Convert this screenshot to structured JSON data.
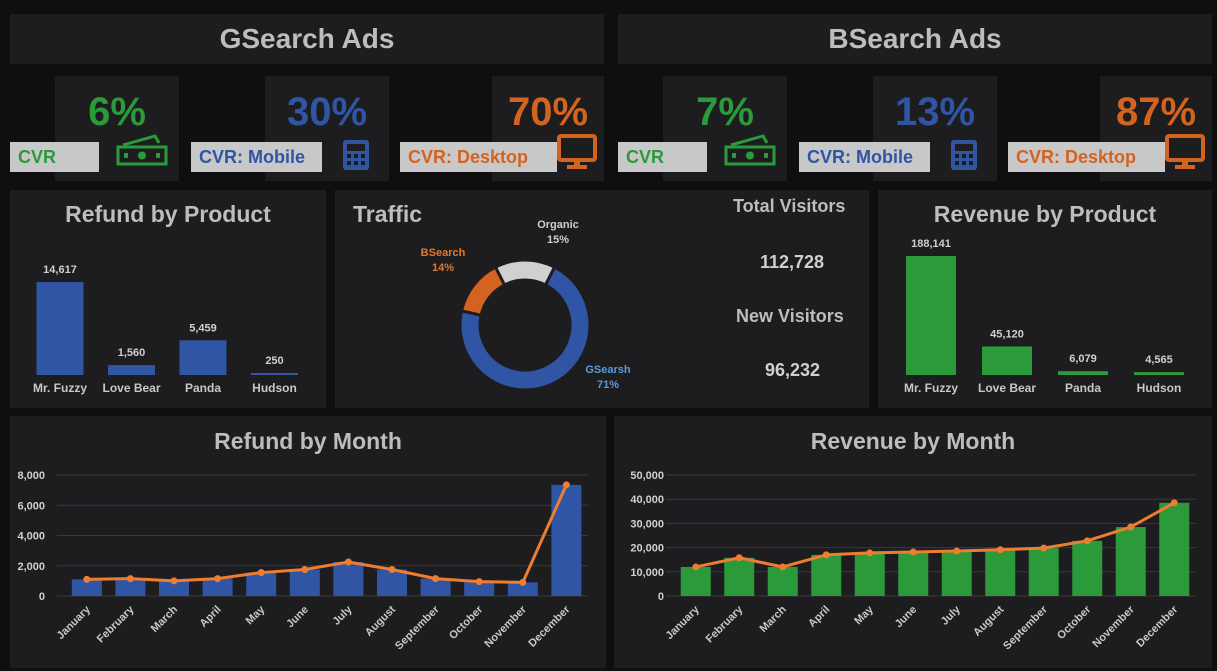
{
  "gsearch": {
    "title": "GSearch Ads",
    "kpis": [
      {
        "value": "6%",
        "label": "CVR",
        "icon": "money-icon",
        "color": "#2a9a3a"
      },
      {
        "value": "30%",
        "label": "CVR: Mobile",
        "icon": "calculator-icon",
        "color": "#2f55a4"
      },
      {
        "value": "70%",
        "label": "CVR: Desktop",
        "icon": "monitor-icon",
        "color": "#d4631f"
      }
    ]
  },
  "bsearch": {
    "title": "BSearch Ads",
    "kpis": [
      {
        "value": "7%",
        "label": "CVR",
        "icon": "money-icon",
        "color": "#2a9a3a"
      },
      {
        "value": "13%",
        "label": "CVR: Mobile",
        "icon": "calculator-icon",
        "color": "#2f55a4"
      },
      {
        "value": "87%",
        "label": "CVR: Desktop",
        "icon": "monitor-icon",
        "color": "#d4631f"
      }
    ]
  },
  "traffic": {
    "total_label": "Total Visitors",
    "total_value": "112,728",
    "new_label": "New Visitors",
    "new_value": "96,232"
  },
  "chart_data": [
    {
      "id": "refund-product",
      "type": "bar",
      "title": "Refund by Product",
      "categories": [
        "Mr. Fuzzy",
        "Love Bear",
        "Panda",
        "Hudson"
      ],
      "values": [
        14617,
        1560,
        5459,
        250
      ],
      "value_labels": [
        "14,617",
        "1,560",
        "5,459",
        "250"
      ],
      "color": "#2f55a4"
    },
    {
      "id": "traffic",
      "type": "pie",
      "title": "Traffic",
      "slices": [
        {
          "name": "GSearsh",
          "value": 71,
          "label": "71%",
          "color": "#2f55a4",
          "label_color": "#5b9bd5"
        },
        {
          "name": "BSearch",
          "value": 14,
          "label": "14%",
          "color": "#d4631f",
          "label_color": "#e0792f"
        },
        {
          "name": "Organic",
          "value": 15,
          "label": "15%",
          "color": "#d0d0d0",
          "label_color": "#d0d0d0"
        }
      ]
    },
    {
      "id": "revenue-product",
      "type": "bar",
      "title": "Revenue by Product",
      "categories": [
        "Mr. Fuzzy",
        "Love Bear",
        "Panda",
        "Hudson"
      ],
      "values": [
        188141,
        45120,
        6079,
        4565
      ],
      "value_labels": [
        "188,141",
        "45,120",
        "6,079",
        "4,565"
      ],
      "color": "#2a9a3a"
    },
    {
      "id": "refund-month",
      "type": "bar",
      "title": "Refund by Month",
      "categories": [
        "January",
        "February",
        "March",
        "April",
        "May",
        "June",
        "July",
        "August",
        "September",
        "October",
        "November",
        "December"
      ],
      "values": [
        1100,
        1150,
        1000,
        1150,
        1550,
        1750,
        2250,
        1750,
        1150,
        950,
        900,
        7350
      ],
      "line_values": [
        1100,
        1150,
        1000,
        1150,
        1550,
        1750,
        2250,
        1750,
        1150,
        950,
        900,
        7350
      ],
      "ylim": [
        0,
        8000
      ],
      "yticks": [
        "0",
        "2,000",
        "4,000",
        "6,000",
        "8,000"
      ],
      "ytick_values": [
        0,
        2000,
        4000,
        6000,
        8000
      ],
      "color": "#2f55a4",
      "line_color": "#ed7d31"
    },
    {
      "id": "revenue-month",
      "type": "bar",
      "title": "Revenue by Month",
      "categories": [
        "January",
        "February",
        "March",
        "April",
        "May",
        "June",
        "July",
        "August",
        "September",
        "October",
        "November",
        "December"
      ],
      "values": [
        12000,
        15800,
        12000,
        17000,
        17800,
        18200,
        18600,
        19100,
        19800,
        22800,
        28500,
        38500
      ],
      "line_values": [
        12000,
        15800,
        12000,
        17000,
        17800,
        18200,
        18600,
        19100,
        19800,
        22800,
        28500,
        38500
      ],
      "ylim": [
        0,
        50000
      ],
      "yticks": [
        "0",
        "10,000",
        "20,000",
        "30,000",
        "40,000",
        "50,000"
      ],
      "ytick_values": [
        0,
        10000,
        20000,
        30000,
        40000,
        50000
      ],
      "color": "#2a9a3a",
      "line_color": "#ed7d31"
    }
  ]
}
